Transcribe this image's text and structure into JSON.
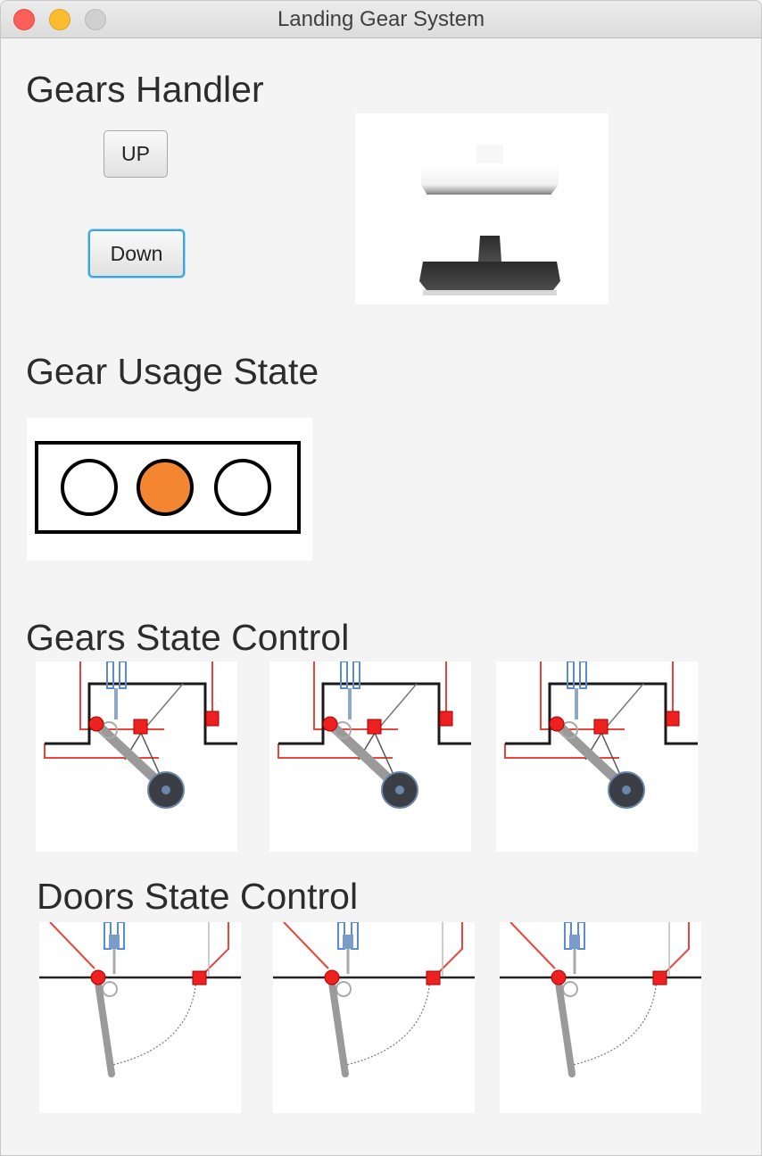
{
  "window": {
    "title": "Landing Gear System"
  },
  "gears_handler": {
    "heading": "Gears Handler",
    "up_label": "UP",
    "down_label": "Down"
  },
  "gear_usage": {
    "heading": "Gear Usage State",
    "lights": [
      {
        "state": "off",
        "color": "#ffffff"
      },
      {
        "state": "on",
        "color": "#f58631"
      },
      {
        "state": "off",
        "color": "#ffffff"
      }
    ]
  },
  "gears_state": {
    "heading": "Gears State Control",
    "count": 3
  },
  "doors_state": {
    "heading": "Doors State Control",
    "count": 3
  }
}
